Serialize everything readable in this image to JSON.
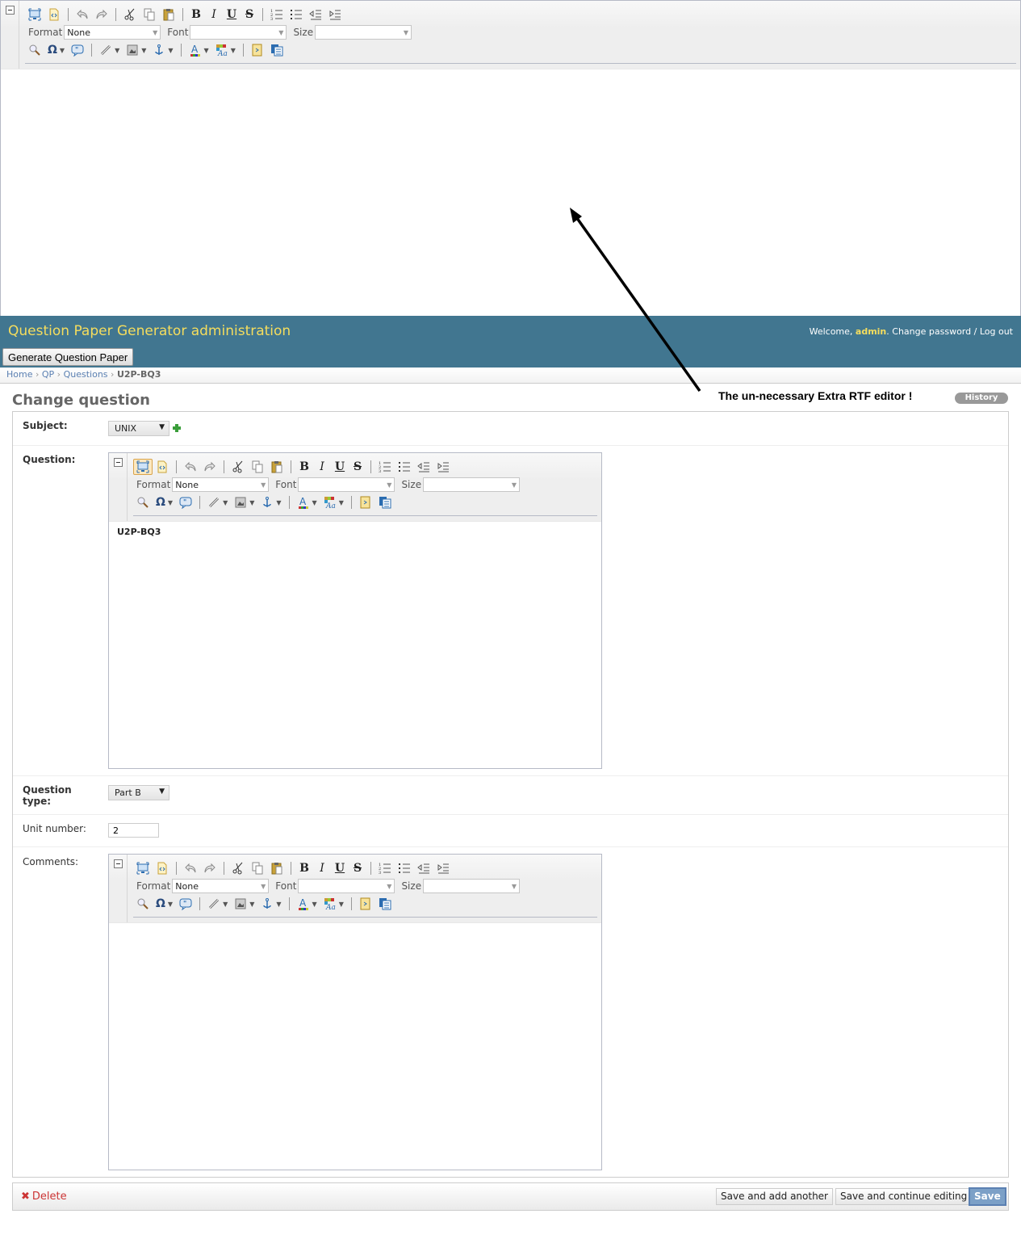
{
  "extra_editor": {
    "format_label": "Format",
    "format_value": "None",
    "font_label": "Font",
    "font_value": "",
    "size_label": "Size",
    "size_value": "",
    "content": ""
  },
  "header": {
    "site_title": "Question Paper Generator administration",
    "welcome_prefix": "Welcome, ",
    "username": "admin",
    "welcome_suffix": ". ",
    "change_password": "Change password",
    "separator": " / ",
    "logout": "Log out",
    "generate_button": "Generate Question Paper"
  },
  "breadcrumbs": {
    "items": [
      "Home",
      "QP",
      "Questions"
    ],
    "sep": " › ",
    "current": "U2P-BQ3"
  },
  "page": {
    "title": "Change question",
    "annotation": "The un-necessary Extra RTF editor !",
    "history_button": "History"
  },
  "form": {
    "subject": {
      "label": "Subject:",
      "value": "UNIX"
    },
    "question": {
      "label": "Question:",
      "format_label": "Format",
      "format_value": "None",
      "font_label": "Font",
      "font_value": "",
      "size_label": "Size",
      "size_value": "",
      "content": "U2P-BQ3"
    },
    "question_type": {
      "label_line1": "Question",
      "label_line2": "type:",
      "value": "Part B"
    },
    "unit_number": {
      "label": "Unit number:",
      "value": "2"
    },
    "comments": {
      "label": "Comments:",
      "format_label": "Format",
      "format_value": "None",
      "font_label": "Font",
      "font_value": "",
      "size_label": "Size",
      "size_value": "",
      "content": ""
    }
  },
  "submit": {
    "delete": "Delete",
    "save_add_another": "Save and add another",
    "save_continue": "Save and continue editing",
    "save": "Save"
  },
  "colors": {
    "header_bg": "#417690",
    "site_title": "#f5dd5d",
    "link": "#5b80b2",
    "delete": "#cc3434",
    "save_button": "#7ca0c7"
  }
}
